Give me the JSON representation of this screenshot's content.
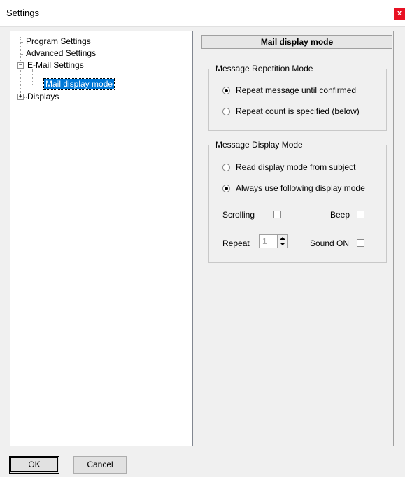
{
  "window": {
    "title": "Settings",
    "close_glyph": "x"
  },
  "tree": {
    "items": [
      {
        "label": "Program Settings"
      },
      {
        "label": "Advanced Settings"
      },
      {
        "label": "E-Mail Settings",
        "expander": "−"
      },
      {
        "label": "Mail display mode",
        "selected": true
      },
      {
        "label": "Displays",
        "expander": "+"
      }
    ]
  },
  "panel": {
    "header": "Mail display mode",
    "repetition_group": {
      "title": "Message Repetition Mode",
      "options": [
        {
          "label": "Repeat message until confirmed",
          "checked": true
        },
        {
          "label": "Repeat count is specified (below)",
          "checked": false
        }
      ]
    },
    "display_group": {
      "title": "Message Display Mode",
      "options": [
        {
          "label": "Read display mode from subject",
          "checked": false
        },
        {
          "label": "Always use following display mode",
          "checked": true
        }
      ],
      "scrolling_label": "Scrolling",
      "beep_label": "Beep",
      "repeat_label": "Repeat",
      "repeat_value": "1",
      "sound_label": "Sound ON"
    }
  },
  "buttons": {
    "ok": "OK",
    "cancel": "Cancel"
  },
  "colors": {
    "selection": "#0078d7",
    "close": "#e81123"
  }
}
